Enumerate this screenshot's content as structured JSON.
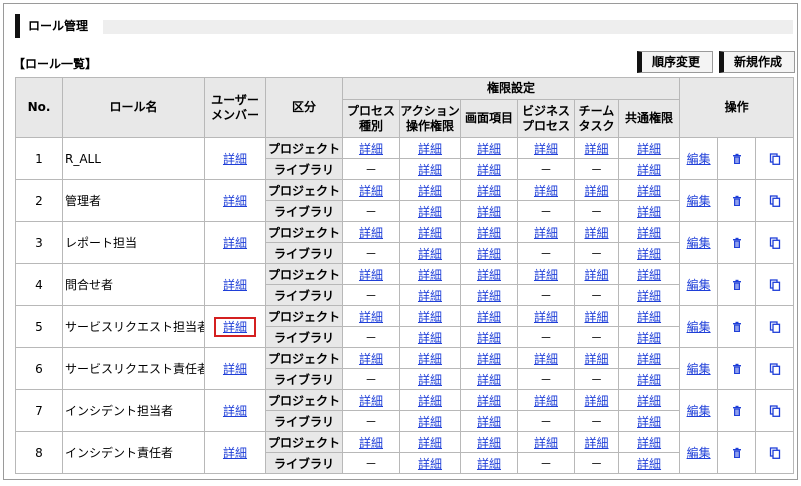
{
  "page": {
    "title": "ロール管理"
  },
  "section": {
    "title": "【ロール一覧】"
  },
  "toolbar": {
    "reorder_label": "順序変更",
    "create_label": "新規作成"
  },
  "table": {
    "headers": {
      "no": "No.",
      "role_name": "ロール名",
      "user_members": "ユーザー\nメンバー",
      "division": "区分",
      "permissions": "権限設定",
      "process_type": "プロセス\n種別",
      "action_perm": "アクション\n操作権限",
      "screen_items": "画面項目",
      "business_process": "ビジネス\nプロセス",
      "team_task": "チーム\nタスク",
      "common_perm": "共通権限",
      "operations": "操作"
    },
    "detail_label": "詳細",
    "dash": "－",
    "edit_label": "編集",
    "scope_project": "プロジェクト",
    "scope_library": "ライブラリ",
    "rows": [
      {
        "no": "1",
        "name": "R_ALL"
      },
      {
        "no": "2",
        "name": "管理者"
      },
      {
        "no": "3",
        "name": "レポート担当"
      },
      {
        "no": "4",
        "name": "問合せ者"
      },
      {
        "no": "5",
        "name": "サービスリクエスト担当者",
        "highlight": true
      },
      {
        "no": "6",
        "name": "サービスリクエスト責任者"
      },
      {
        "no": "7",
        "name": "インシデント担当者"
      },
      {
        "no": "8",
        "name": "インシデント責任者"
      }
    ]
  },
  "icons": {
    "delete": "trash-icon",
    "copy": "copy-icon"
  },
  "colors": {
    "link": "#1f3fd8",
    "highlight": "#d42020",
    "header_bg": "#e8e8e8"
  }
}
